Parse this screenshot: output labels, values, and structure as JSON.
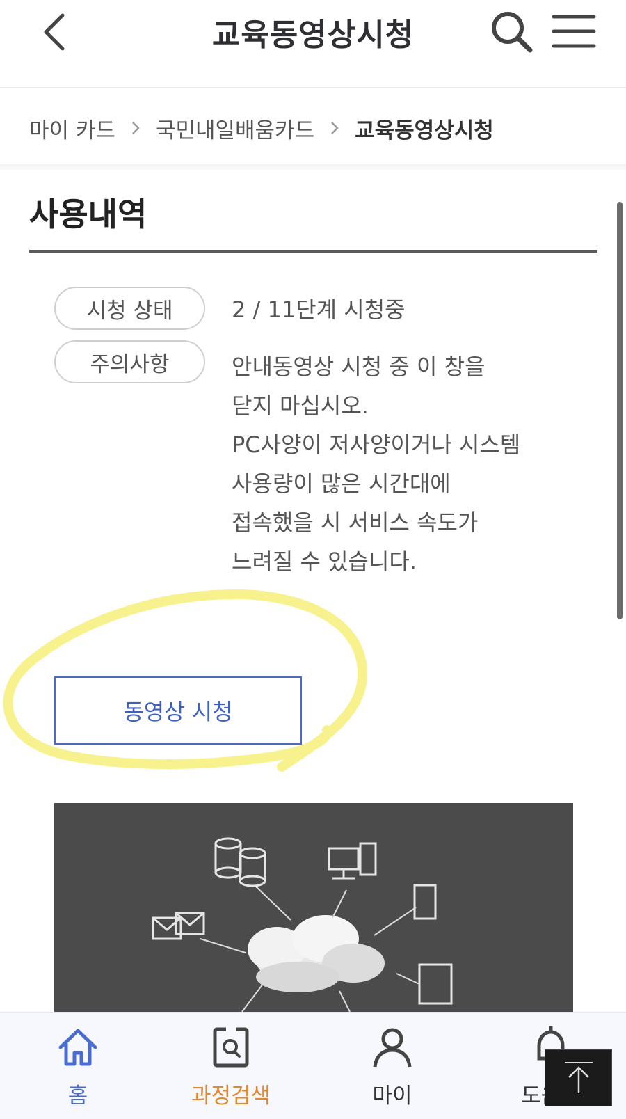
{
  "header": {
    "title": "교육동영상시청",
    "back_icon": "chevron-left-icon",
    "search_icon": "search-icon",
    "menu_icon": "hamburger-menu-icon"
  },
  "breadcrumb": {
    "items": [
      "마이 카드",
      "국민내일배움카드",
      "교육동영상시청"
    ]
  },
  "section": {
    "title": "사용내역"
  },
  "info": {
    "status_label": "시청 상태",
    "status_value": "2 / 11단계 시청중",
    "notice_label": "주의사항",
    "notice_lines": [
      "안내동영상 시청 중 이 창을",
      "닫지 마십시오.",
      "PC사양이 저사양이거나 시스템",
      "사용량이 많은 시간대에",
      "접속했을 시 서비스 속도가",
      "느려질 수 있습니다."
    ]
  },
  "actions": {
    "watch_label": "동영상 시청"
  },
  "tabbar": {
    "tabs": [
      {
        "label": "홈",
        "icon": "home-icon"
      },
      {
        "label": "과정검색",
        "icon": "course-search-icon"
      },
      {
        "label": "마이",
        "icon": "user-icon"
      },
      {
        "label": "도움말",
        "icon": "bell-icon"
      }
    ],
    "top_icon": "arrow-up-icon"
  },
  "colors": {
    "accent_blue": "#3f62c2",
    "accent_orange": "#e28a2b",
    "highlight_yellow": "#f6f07a",
    "title_text": "#2f2f33"
  }
}
